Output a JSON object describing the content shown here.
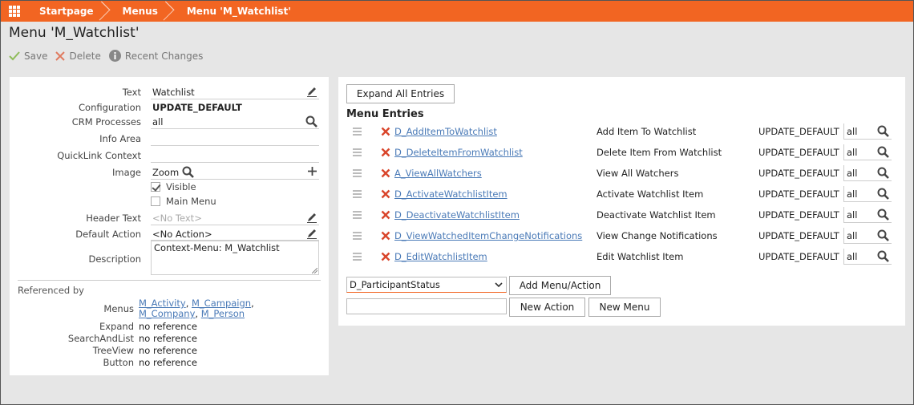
{
  "breadcrumb": [
    "Startpage",
    "Menus",
    "Menu 'M_Watchlist'"
  ],
  "page_title": "Menu 'M_Watchlist'",
  "toolbar": {
    "save": "Save",
    "delete": "Delete",
    "recent": "Recent Changes"
  },
  "form": {
    "text_label": "Text",
    "text_value": "Watchlist",
    "config_label": "Configuration",
    "config_value": "UPDATE_DEFAULT",
    "crm_label": "CRM Processes",
    "crm_value": "all",
    "info_label": "Info Area",
    "info_value": "",
    "quicklink_label": "QuickLink Context",
    "quicklink_value": "",
    "image_label": "Image",
    "image_value": "Zoom",
    "visible_label": "Visible",
    "visible_checked": true,
    "mainmenu_label": "Main Menu",
    "mainmenu_checked": false,
    "header_label": "Header Text",
    "header_placeholder": "<No Text>",
    "default_action_label": "Default Action",
    "default_action_value": "<No Action>",
    "description_label": "Description",
    "description_value": "Context-Menu: M_Watchlist"
  },
  "referenced": {
    "title": "Referenced by",
    "menus_label": "Menus",
    "menus": [
      "M_Activity",
      "M_Campaign",
      "M_Company",
      "M_Person"
    ],
    "expand_label": "Expand",
    "expand_value": "no reference",
    "search_label": "SearchAndList",
    "search_value": "no reference",
    "tree_label": "TreeView",
    "tree_value": "no reference",
    "button_label": "Button",
    "button_value": "no reference"
  },
  "entries_panel": {
    "expand_all": "Expand All Entries",
    "title": "Menu Entries",
    "entries": [
      {
        "name": "D_AddItemToWatchlist",
        "desc": "Add Item To Watchlist",
        "config": "UPDATE_DEFAULT",
        "process": "all"
      },
      {
        "name": "D_DeleteItemFromWatchlist",
        "desc": "Delete Item From Watchlist",
        "config": "UPDATE_DEFAULT",
        "process": "all"
      },
      {
        "name": "A_ViewAllWatchers",
        "desc": "View All Watchers",
        "config": "UPDATE_DEFAULT",
        "process": "all"
      },
      {
        "name": "D_ActivateWatchlistItem",
        "desc": "Activate Watchlist Item",
        "config": "UPDATE_DEFAULT",
        "process": "all"
      },
      {
        "name": "D_DeactivateWatchlistItem",
        "desc": "Deactivate Watchlist Item",
        "config": "UPDATE_DEFAULT",
        "process": "all"
      },
      {
        "name": "D_ViewWatchedItemChangeNotifications",
        "desc": "View Change Notifications",
        "config": "UPDATE_DEFAULT",
        "process": "all"
      },
      {
        "name": "D_EditWatchlistItem",
        "desc": "Edit Watchlist Item",
        "config": "UPDATE_DEFAULT",
        "process": "all"
      }
    ],
    "select_value": "D_ParticipantStatus",
    "add_btn": "Add Menu/Action",
    "new_action_btn": "New Action",
    "new_menu_btn": "New Menu"
  },
  "colors": {
    "brand": "#f26522",
    "link": "#4a7ab7",
    "delete": "#d9452b"
  }
}
